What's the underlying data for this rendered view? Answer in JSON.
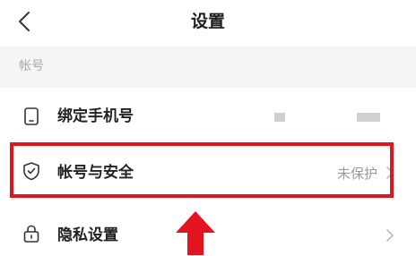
{
  "header": {
    "title": "设置",
    "back_icon": "chevron-left-icon"
  },
  "section": {
    "title": "帐号"
  },
  "rows": [
    {
      "label": "绑定手机号",
      "value": "",
      "icon": "phone-icon"
    },
    {
      "label": "帐号与安全",
      "value": "未保护",
      "icon": "shield-check-icon"
    },
    {
      "label": "隐私设置",
      "value": "",
      "icon": "lock-icon"
    }
  ],
  "annotation": {
    "highlight_color": "#e2141d",
    "arrow_direction": "up"
  }
}
